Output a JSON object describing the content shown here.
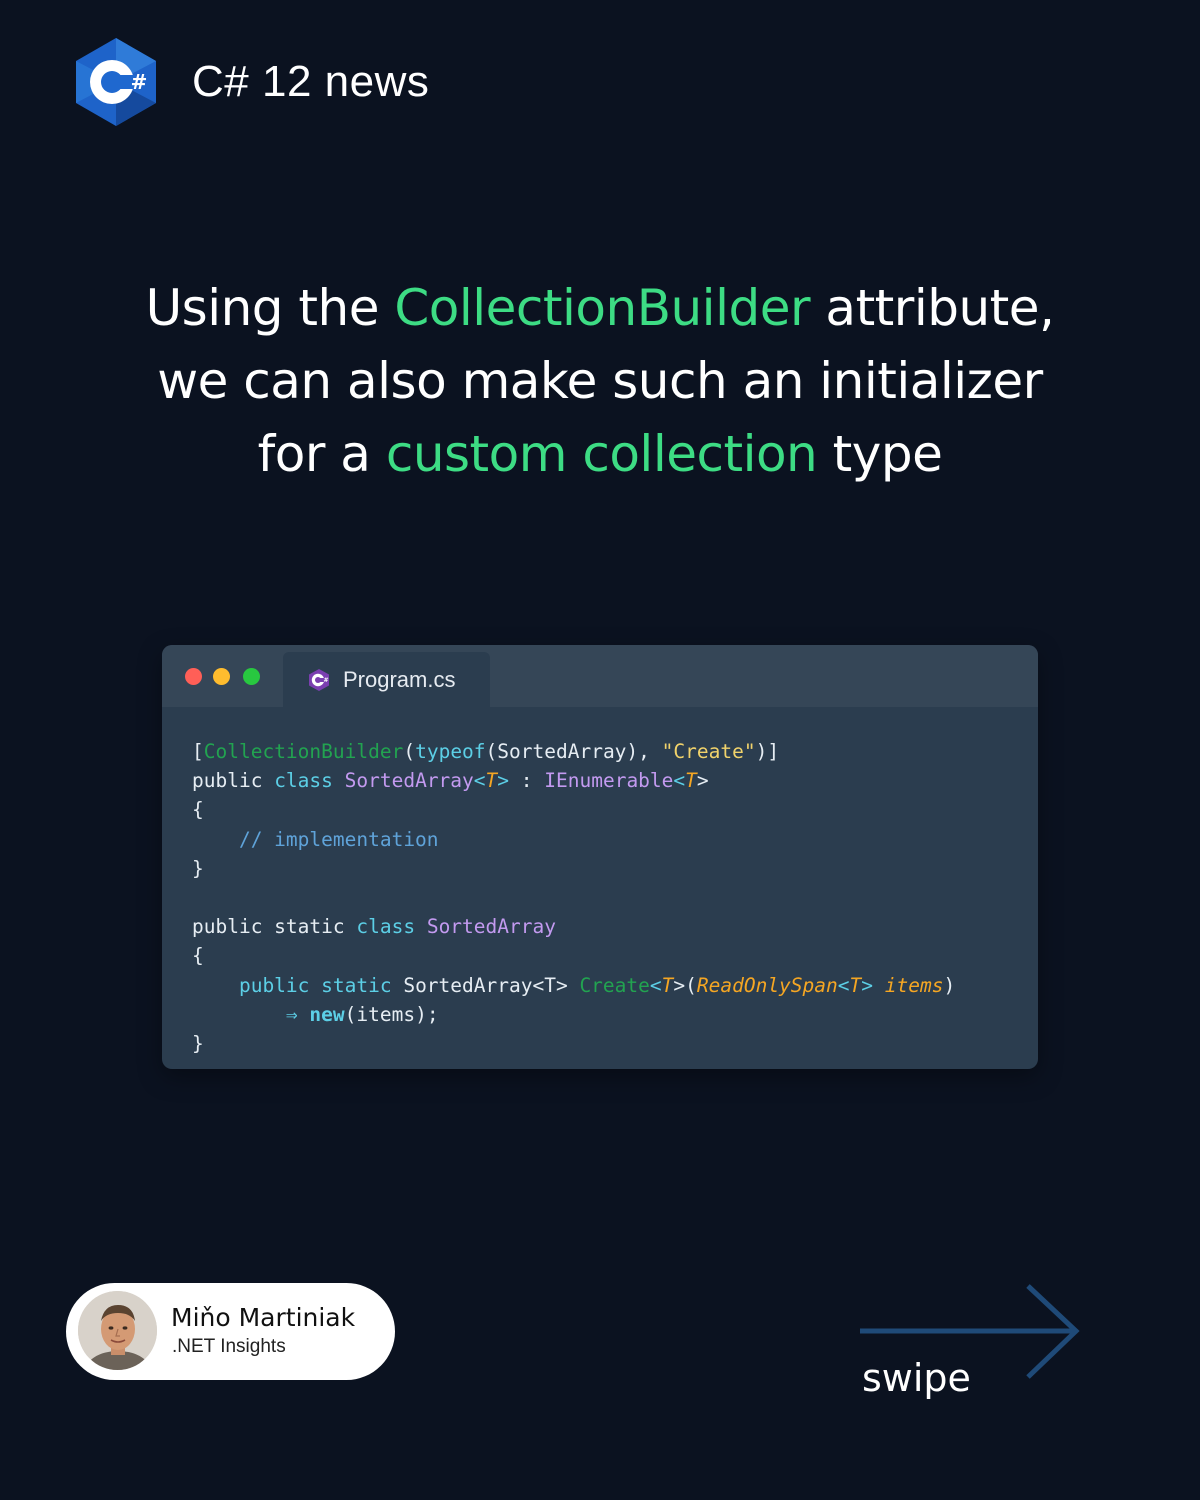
{
  "header": {
    "logo_icon": "csharp-logo-icon",
    "title": "C# 12 news"
  },
  "headline": {
    "line1": {
      "before": "Using the ",
      "accent": "CollectionBuilder",
      "after": " attribute,"
    },
    "line2": {
      "text": "we can also make such an initializer"
    },
    "line3": {
      "before": "for a ",
      "accent": "custom collection",
      "after": " type"
    },
    "accent_color": "#3ddc84"
  },
  "code_window": {
    "tab_icon": "csharp-file-icon",
    "tab_label": "Program.cs",
    "window_controls": [
      "close-dot",
      "minimize-dot",
      "maximize-dot"
    ],
    "lines": [
      [
        [
          "punc",
          "["
        ],
        [
          "attr",
          "CollectionBuilder"
        ],
        [
          "punc",
          "("
        ],
        [
          "kw",
          "typeof"
        ],
        [
          "punc",
          "(SortedArray), "
        ],
        [
          "str",
          "\"Create\""
        ],
        [
          "punc",
          ")]"
        ]
      ],
      [
        [
          "plain",
          "public "
        ],
        [
          "kw",
          "class "
        ],
        [
          "type",
          "SortedArray"
        ],
        [
          "kw",
          "<"
        ],
        [
          "gen",
          "T"
        ],
        [
          "kw",
          ">"
        ],
        [
          "plain",
          " : "
        ],
        [
          "type",
          "IEnumerable"
        ],
        [
          "kw",
          "<"
        ],
        [
          "gen",
          "T"
        ],
        [
          "plain",
          ">"
        ]
      ],
      [
        [
          "plain",
          "{"
        ]
      ],
      [
        [
          "cmt",
          "    // implementation"
        ]
      ],
      [
        [
          "plain",
          "}"
        ]
      ],
      [
        [
          "plain",
          ""
        ]
      ],
      [
        [
          "plain",
          "public static "
        ],
        [
          "kw",
          "class "
        ],
        [
          "type",
          "SortedArray"
        ]
      ],
      [
        [
          "plain",
          "{"
        ]
      ],
      [
        [
          "kw",
          "    public static "
        ],
        [
          "plain",
          "SortedArray<T> "
        ],
        [
          "meth",
          "Create"
        ],
        [
          "kw",
          "<"
        ],
        [
          "gen",
          "T"
        ],
        [
          "plain",
          ">("
        ],
        [
          "gen",
          "ReadOnlySpan"
        ],
        [
          "kw",
          "<"
        ],
        [
          "gen",
          "T"
        ],
        [
          "kw",
          "> "
        ],
        [
          "gen",
          "items"
        ],
        [
          "plain",
          ")"
        ]
      ],
      [
        [
          "plain",
          "        "
        ],
        [
          "kw",
          "⇒ "
        ],
        [
          "bold",
          "new"
        ],
        [
          "plain",
          "(items);"
        ]
      ],
      [
        [
          "plain",
          "}"
        ]
      ]
    ]
  },
  "author": {
    "avatar_icon": "author-avatar",
    "name": "Miňo Martiniak",
    "subtitle": ".NET Insights"
  },
  "swipe": {
    "arrow_icon": "right-arrow-icon",
    "label": "swipe"
  }
}
